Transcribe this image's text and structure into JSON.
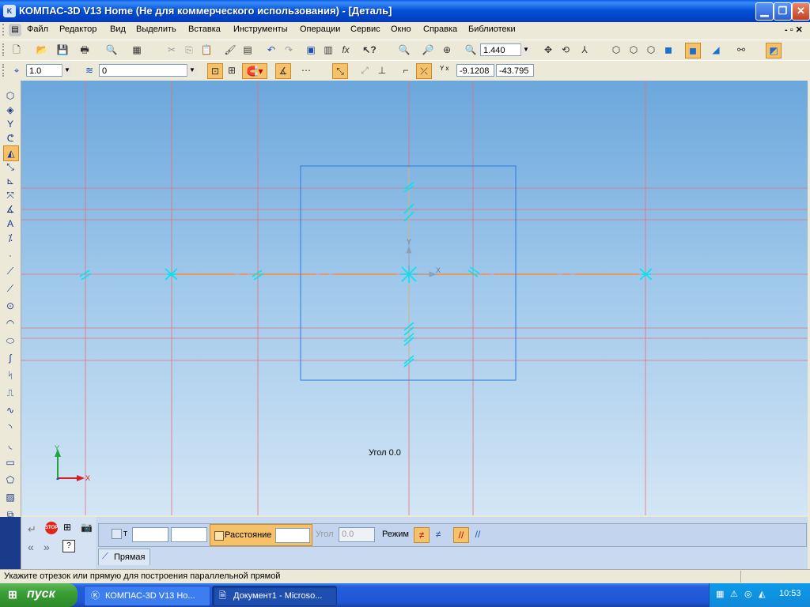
{
  "window": {
    "title": "КОМПАС-3D V13 Home (Не для коммерческого использования) - [Деталь]",
    "app_icon_text": "K",
    "min_glyph": "▁",
    "max_glyph": "❐",
    "close_glyph": "✕"
  },
  "menu": {
    "items": [
      "Файл",
      "Редактор",
      "Вид",
      "Выделить",
      "Вставка",
      "Инструменты",
      "Операции",
      "Сервис",
      "Окно",
      "Справка",
      "Библиотеки"
    ],
    "doc_controls": "- ▫ ✕"
  },
  "toolbar_main": {
    "zoom_value": "1.440"
  },
  "toolbar_props": {
    "step_value": "1.0",
    "layer_value": "0",
    "coord_x": "-9.1208",
    "coord_y": "-43.795",
    "coord_label": "Y x"
  },
  "canvas": {
    "angle_label": "Угол 0.0",
    "axis_x": "X",
    "axis_y": "Y",
    "origin_x_label": "X",
    "origin_y_label": "Y",
    "colors": {
      "construction_line": "#e8707a",
      "selection_rect": "#2a7de0",
      "marker": "#00e5f0",
      "axis_line": "#ff8a2a"
    }
  },
  "property_panel": {
    "t_label": "т",
    "distance_label": "Расстояние",
    "angle_label": "Угол",
    "angle_value": "0.0",
    "mode_label": "Режим",
    "tab_label": "Прямая"
  },
  "status": {
    "hint": "Укажите отрезок или прямую для построения параллельной прямой"
  },
  "taskbar": {
    "start_label": "пуск",
    "items": [
      {
        "label": "КОМПАС-3D V13 Ho..."
      },
      {
        "label": "Документ1 - Microso..."
      }
    ],
    "clock": "10:53"
  }
}
